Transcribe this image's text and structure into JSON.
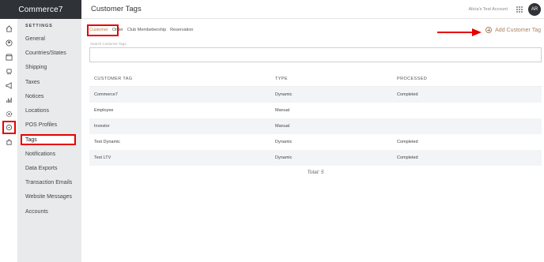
{
  "brand": {
    "name": "Commerce7"
  },
  "header": {
    "title": "Customer Tags",
    "account": "Alicia's Test Account",
    "avatar_initials": "AR"
  },
  "settings_menu": {
    "heading": "SETTINGS",
    "items": [
      {
        "label": "General"
      },
      {
        "label": "Countries/States"
      },
      {
        "label": "Shipping"
      },
      {
        "label": "Taxes"
      },
      {
        "label": "Notices"
      },
      {
        "label": "Locations"
      },
      {
        "label": "POS Profiles"
      },
      {
        "label": "Tags"
      },
      {
        "label": "Notifications"
      },
      {
        "label": "Data Exports"
      },
      {
        "label": "Transaction Emails"
      },
      {
        "label": "Website Messages"
      },
      {
        "label": "Accounts"
      }
    ]
  },
  "rail_icons": [
    "home-icon",
    "users-icon",
    "store-icon",
    "cart-icon",
    "megaphone-icon",
    "reports-icon",
    "settings-gear-icon",
    "circle-icon",
    "puzzle-icon"
  ],
  "tabs": [
    {
      "label": "Customer"
    },
    {
      "label": "Order"
    },
    {
      "label": "Club Membebership"
    },
    {
      "label": "Reservation"
    }
  ],
  "add_button": {
    "label": "Add Customer Tag"
  },
  "search": {
    "label": "Search Customer Tags",
    "value": ""
  },
  "table": {
    "headers": {
      "tag": "CUSTOMER TAG",
      "type": "TYPE",
      "processed": "PROCESSED"
    },
    "rows": [
      {
        "tag": "Commerce7",
        "type": "Dynamic",
        "processed": "Completed"
      },
      {
        "tag": "Employee",
        "type": "Manual",
        "processed": ""
      },
      {
        "tag": "Investor",
        "type": "Manual",
        "processed": ""
      },
      {
        "tag": "Test Dynamic",
        "type": "Dynamic",
        "processed": "Completed"
      },
      {
        "tag": "Test LTV",
        "type": "Dynamic",
        "processed": "Completed"
      }
    ]
  },
  "total": "Total: 5",
  "colors": {
    "highlight": "#e60000",
    "accent": "#a98464",
    "sidebar_bg": "#e8eaec",
    "brand_bg": "#2f3236"
  }
}
